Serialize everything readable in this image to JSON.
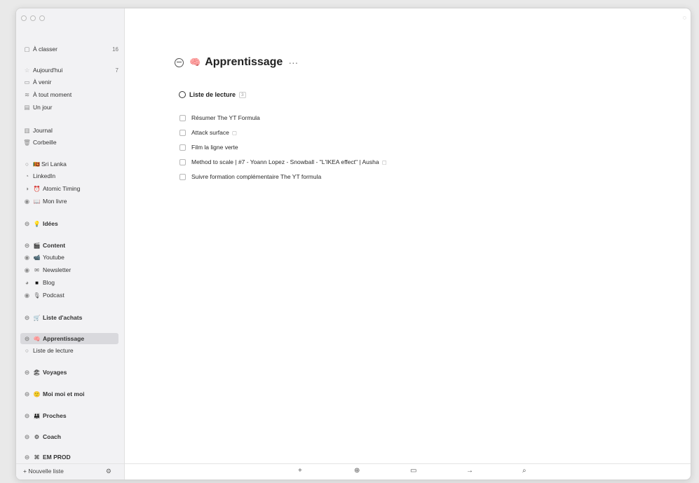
{
  "sidebar": {
    "inbox": {
      "label": "À classer",
      "count": "16"
    },
    "today": {
      "label": "Aujourd'hui",
      "count": "7"
    },
    "upcoming": {
      "label": "À venir"
    },
    "anytime": {
      "label": "À tout moment"
    },
    "someday": {
      "label": "Un jour"
    },
    "logbook": {
      "label": "Journal"
    },
    "trash": {
      "label": "Corbeille"
    },
    "projects": [
      {
        "label": "Sri Lanka",
        "icon": "🇱🇰"
      },
      {
        "label": "LinkedIn",
        "icon": "◔"
      },
      {
        "label": "Atomic Timing",
        "icon": "⏰"
      },
      {
        "label": "Mon livre",
        "icon": "📖"
      }
    ],
    "areas": {
      "ideas": {
        "label": "Idées",
        "icon": "💡"
      },
      "content": {
        "label": "Content",
        "icon": "🎬"
      },
      "content_items": [
        {
          "label": "Youtube",
          "icon": "📹"
        },
        {
          "label": "Newsletter",
          "icon": "✉"
        },
        {
          "label": "Blog",
          "icon": "■"
        },
        {
          "label": "Podcast",
          "icon": "🎙"
        }
      ],
      "shopping": {
        "label": "Liste d'achats",
        "icon": "🛒"
      },
      "learning": {
        "label": "Apprentissage",
        "icon": "🧠"
      },
      "reading_list": {
        "label": "Liste de lecture"
      },
      "travel": {
        "label": "Voyages",
        "icon": "🏖"
      },
      "me": {
        "label": "Moi moi et moi",
        "icon": "🙂"
      },
      "family": {
        "label": "Proches",
        "icon": "👨‍👩‍👧"
      },
      "coach": {
        "label": "Coach",
        "icon": "⚙"
      },
      "emprod": {
        "label": "EM PROD",
        "icon": "⌘"
      }
    },
    "footer": {
      "new_list": "+ Nouvelle liste",
      "settings_icon": "⚙"
    }
  },
  "main": {
    "title": "Apprentissage",
    "title_icon": "🧠",
    "more": "···",
    "heading": "Liste de lecture",
    "heading_tag": "3",
    "tasks": [
      {
        "label": "Résumer The YT Formula",
        "note": ""
      },
      {
        "label": "Attack surface",
        "note": "▢"
      },
      {
        "label": "Film la ligne verte",
        "note": ""
      },
      {
        "label": "Method to scale | #7 - Yoann Lopez - Snowball - \"L'IKEA effect\" | Ausha",
        "note": "▢"
      },
      {
        "label": "Suivre formation complémentaire The YT formula",
        "note": ""
      }
    ]
  },
  "toolbar": {
    "add": "+",
    "checklist": "⊕",
    "calendar": "▭",
    "move": "→",
    "search": "⌕"
  }
}
